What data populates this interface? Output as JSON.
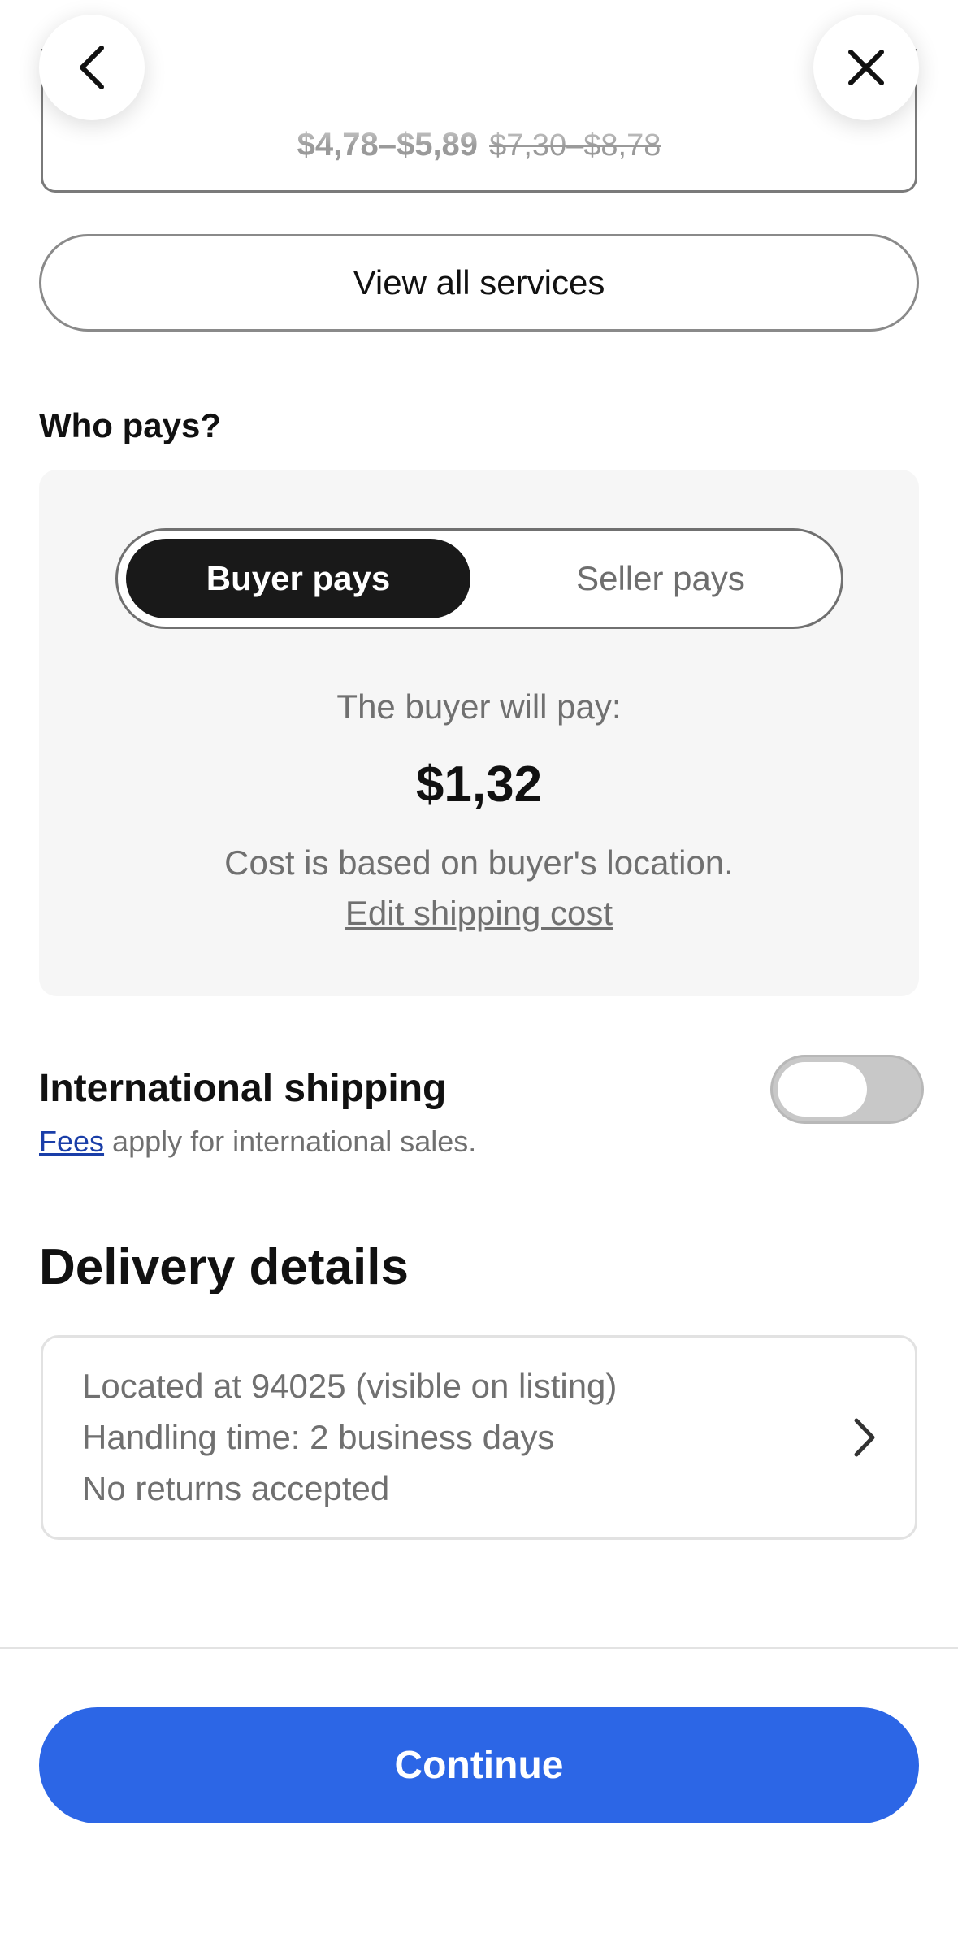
{
  "header": {
    "back_icon": "chevron-left-icon",
    "close_icon": "close-icon"
  },
  "service_card": {
    "price_range": "$4,78–$5,89",
    "original_range": "$7,30–$8,78"
  },
  "view_all_label": "View all services",
  "who_pays": {
    "label": "Who pays?",
    "options": [
      "Buyer pays",
      "Seller pays"
    ],
    "selected": "Buyer pays",
    "caption": "The buyer will pay:",
    "amount": "$1,32",
    "note": "Cost is based on buyer's location.",
    "edit_link": "Edit shipping cost"
  },
  "international": {
    "title": "International shipping",
    "fees_link": "Fees",
    "fees_text": " apply for international sales.",
    "enabled": false
  },
  "delivery": {
    "title": "Delivery details",
    "lines": [
      "Located at 94025 (visible on listing)",
      "Handling time: 2 business days",
      "No returns accepted"
    ],
    "icon": "chevron-right-icon"
  },
  "footer": {
    "continue_label": "Continue"
  },
  "colors": {
    "accent": "#2c66e6",
    "link": "#1a3ea8",
    "selected_segment": "#191919",
    "panel_bg": "#f6f6f6"
  }
}
